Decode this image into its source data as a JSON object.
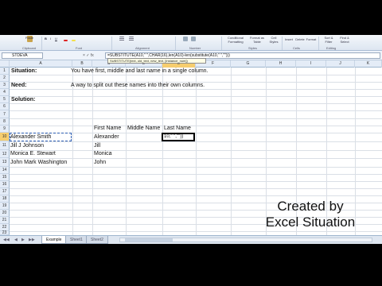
{
  "ribbon": {
    "paste_label": "Paste",
    "clipboard_group": "Clipboard",
    "font_group": "Font",
    "alignment_group": "Alignment",
    "number_group": "Number",
    "styles_group": "Styles",
    "cells_group": "Cells",
    "editing_group": "Editing",
    "conditional_formatting": "Conditional Formatting",
    "format_as_table": "Format as Table",
    "cell_styles": "Cell Styles",
    "insert_label": "Insert",
    "delete_label": "Delete",
    "format_label": "Format",
    "sort_filter": "Sort & Filter",
    "find_select": "Find & Select"
  },
  "formula_bar": {
    "name_box": "STDEVA",
    "fx_icons": "× ✓ fx",
    "formula": "=SUBSTITUTE(A10,\" \",CHAR(16),len(A10)-len(substitute(A10,\" \",\"\")))",
    "tooltip": "SUBSTITUTE(text, old_text, new_text, [instance_num])"
  },
  "columns": [
    "A",
    "B",
    "C",
    "D",
    "E",
    "F",
    "G",
    "H",
    "I",
    "J",
    "K"
  ],
  "active_column": "E",
  "rows": [
    "1",
    "2",
    "3",
    "4",
    "5",
    "6",
    "7",
    "8",
    "9",
    "10",
    "11",
    "12",
    "13",
    "14",
    "15",
    "16",
    "17",
    "18",
    "19",
    "20",
    "21",
    "22",
    "23"
  ],
  "active_row": "10",
  "cells": {
    "situation_label": "Situation:",
    "situation_text": "You have first, middle and last name in a single column.",
    "need_label": "Need:",
    "need_text": "A way to split out these names into their own columns.",
    "solution_label": "Solution:",
    "first_name_header": "First Name",
    "middle_name_header": "Middle Name",
    "last_name_header": "Last Name",
    "name_1": "Alexander Smith",
    "name_2": "Jill J Johnson",
    "name_3": "Monica E. Stewart",
    "name_4": "John Mark Washington",
    "first_1": "Alexander",
    "first_2": "Jill",
    "first_3": "Monica",
    "first_4": "John",
    "editing_value": "10,\" \",\"\"))"
  },
  "watermark": {
    "line1": "Created by",
    "line2": "Excel Situation"
  },
  "sheet_tabs": [
    "Example",
    "Sheet1",
    "Sheet2"
  ],
  "active_tab": "Example"
}
